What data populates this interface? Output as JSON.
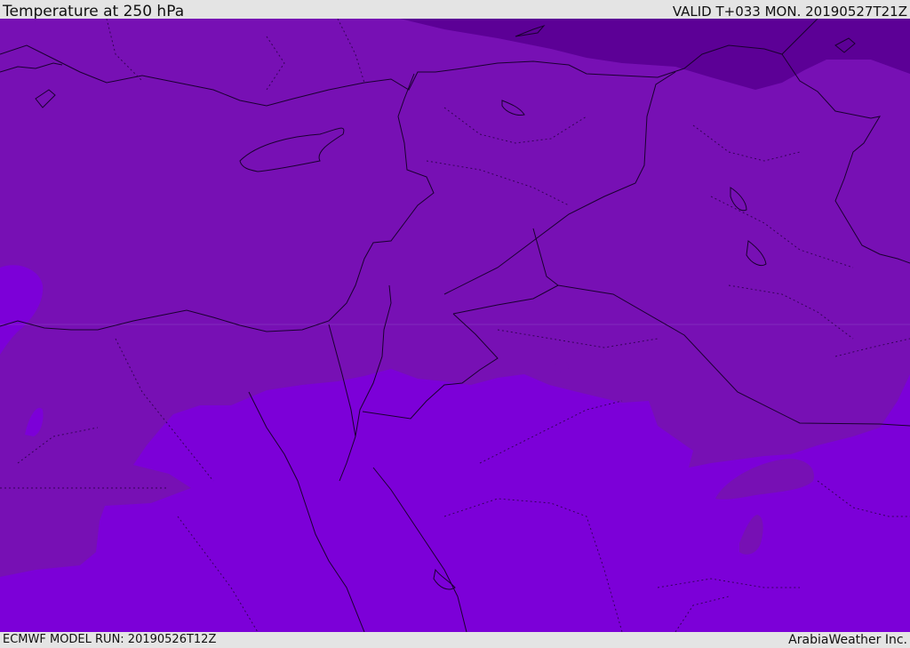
{
  "header": {
    "title": "Temperature at 250 hPa",
    "valid": "VALID T+033 MON. 20190527T21Z"
  },
  "footer": {
    "model_run": "ECMWF MODEL RUN: 20190526T12Z",
    "brand": "ArabiaWeather Inc."
  },
  "colors": {
    "band_cold": "#5c0096",
    "band_mid": "#7710b4",
    "band_warm": "#7c00d8",
    "background_bar": "#e4e4e4",
    "coastline": "#1a0030"
  }
}
